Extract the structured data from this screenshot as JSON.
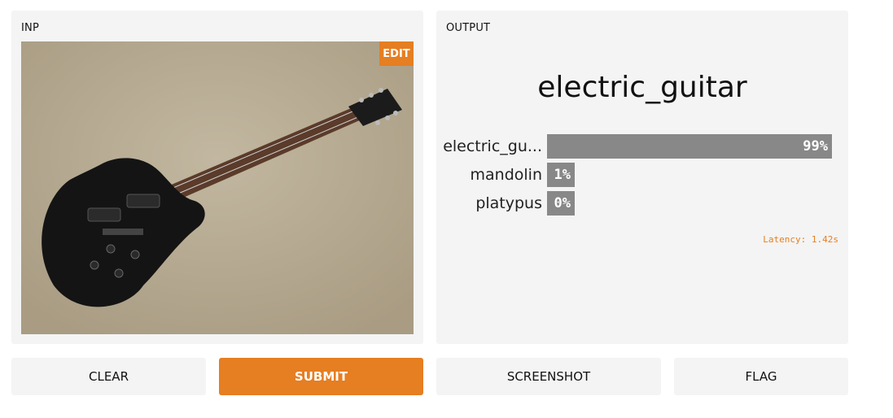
{
  "input_panel": {
    "label": "INP",
    "edit_label": "EDIT"
  },
  "output_panel": {
    "label": "OUTPUT",
    "prediction": "electric_guitar",
    "confidences": [
      {
        "label": "electric_gu...",
        "percent_text": "99%",
        "value": 0.99
      },
      {
        "label": "mandolin",
        "percent_text": "1%",
        "value": 0.01
      },
      {
        "label": "platypus",
        "percent_text": "0%",
        "value": 0.0
      }
    ],
    "latency": "Latency: 1.42s"
  },
  "buttons": {
    "clear": "CLEAR",
    "submit": "SUBMIT",
    "screenshot": "SCREENSHOT",
    "flag": "FLAG"
  },
  "colors": {
    "accent": "#e67e22",
    "bar": "#888888",
    "panel": "#f4f4f4"
  },
  "image": {
    "subject": "black electric guitar on carpet"
  }
}
